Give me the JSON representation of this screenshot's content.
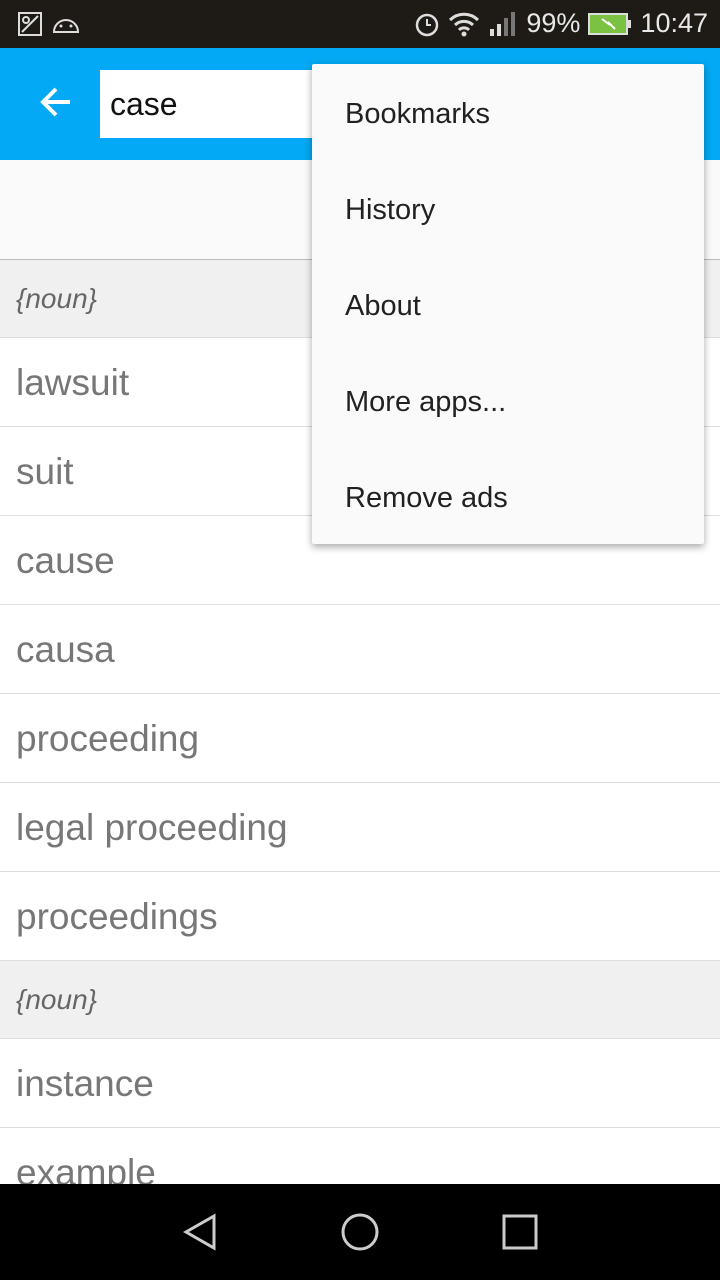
{
  "status_bar": {
    "battery": "99%",
    "time": "10:47",
    "battery_color": "#7cc242"
  },
  "app_bar": {
    "color": "#03a9f4",
    "search_value": "case"
  },
  "list": [
    {
      "type": "header",
      "text": "{noun}"
    },
    {
      "type": "item",
      "text": "lawsuit"
    },
    {
      "type": "item",
      "text": "suit"
    },
    {
      "type": "item",
      "text": "cause"
    },
    {
      "type": "item",
      "text": "causa"
    },
    {
      "type": "item",
      "text": "proceeding"
    },
    {
      "type": "item",
      "text": "legal proceeding"
    },
    {
      "type": "item",
      "text": "proceedings"
    },
    {
      "type": "header",
      "text": "{noun}"
    },
    {
      "type": "item",
      "text": "instance"
    },
    {
      "type": "item",
      "text": "example"
    }
  ],
  "menu": [
    "Bookmarks",
    "History",
    "About",
    "More apps...",
    "Remove ads"
  ]
}
